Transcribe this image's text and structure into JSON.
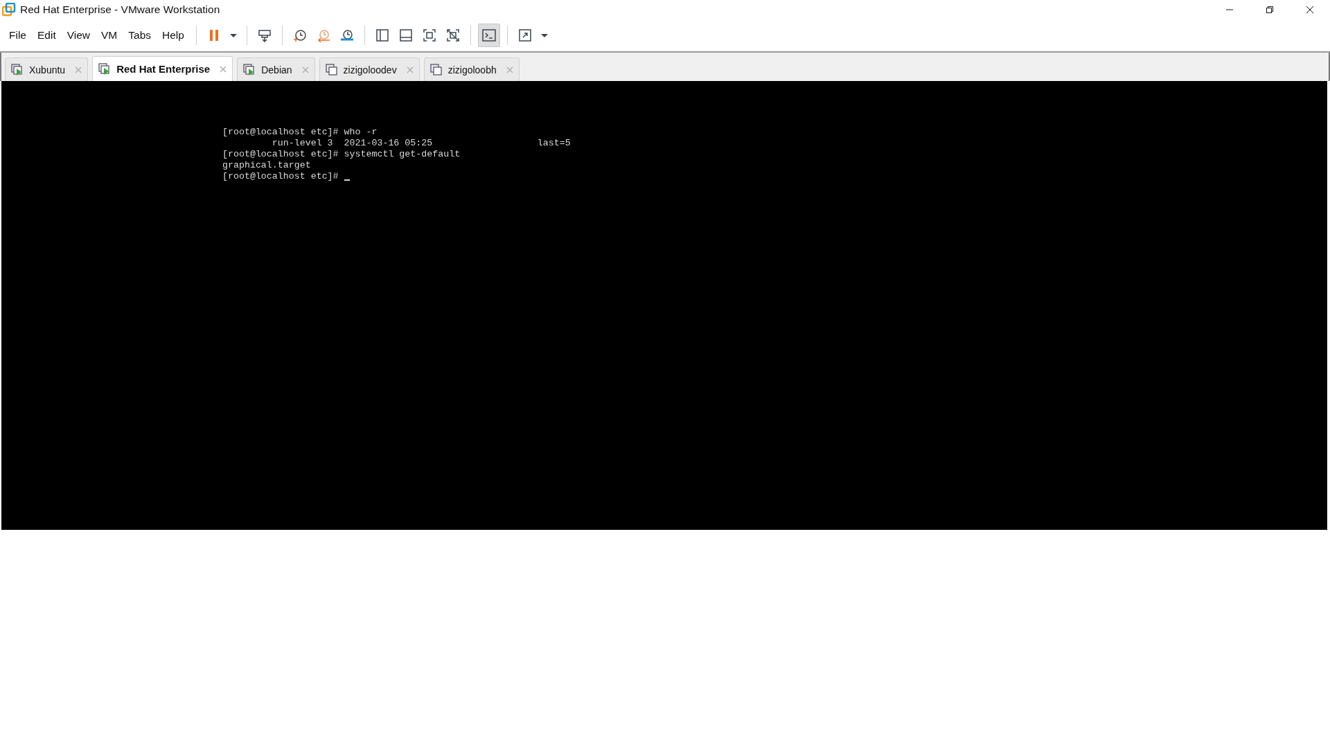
{
  "window": {
    "title": "Red Hat Enterprise - VMware Workstation"
  },
  "menu": [
    "File",
    "Edit",
    "View",
    "VM",
    "Tabs",
    "Help"
  ],
  "toolbar": {
    "console_view_on": true
  },
  "tabs": [
    {
      "label": "Xubuntu",
      "kind": "running",
      "selected": false
    },
    {
      "label": "Red Hat Enterprise",
      "kind": "running",
      "selected": true
    },
    {
      "label": "Debian",
      "kind": "running",
      "selected": false
    },
    {
      "label": "zizigoloodev",
      "kind": "stopped",
      "selected": false
    },
    {
      "label": "zizigoloobh",
      "kind": "stopped",
      "selected": false
    }
  ],
  "console": {
    "lines": [
      "[root@localhost etc]# who -r",
      "         run-level 3  2021-03-16 05:25                   last=5",
      "[root@localhost etc]# systemctl get-default",
      "graphical.target",
      "[root@localhost etc]# "
    ],
    "cursor": true
  }
}
